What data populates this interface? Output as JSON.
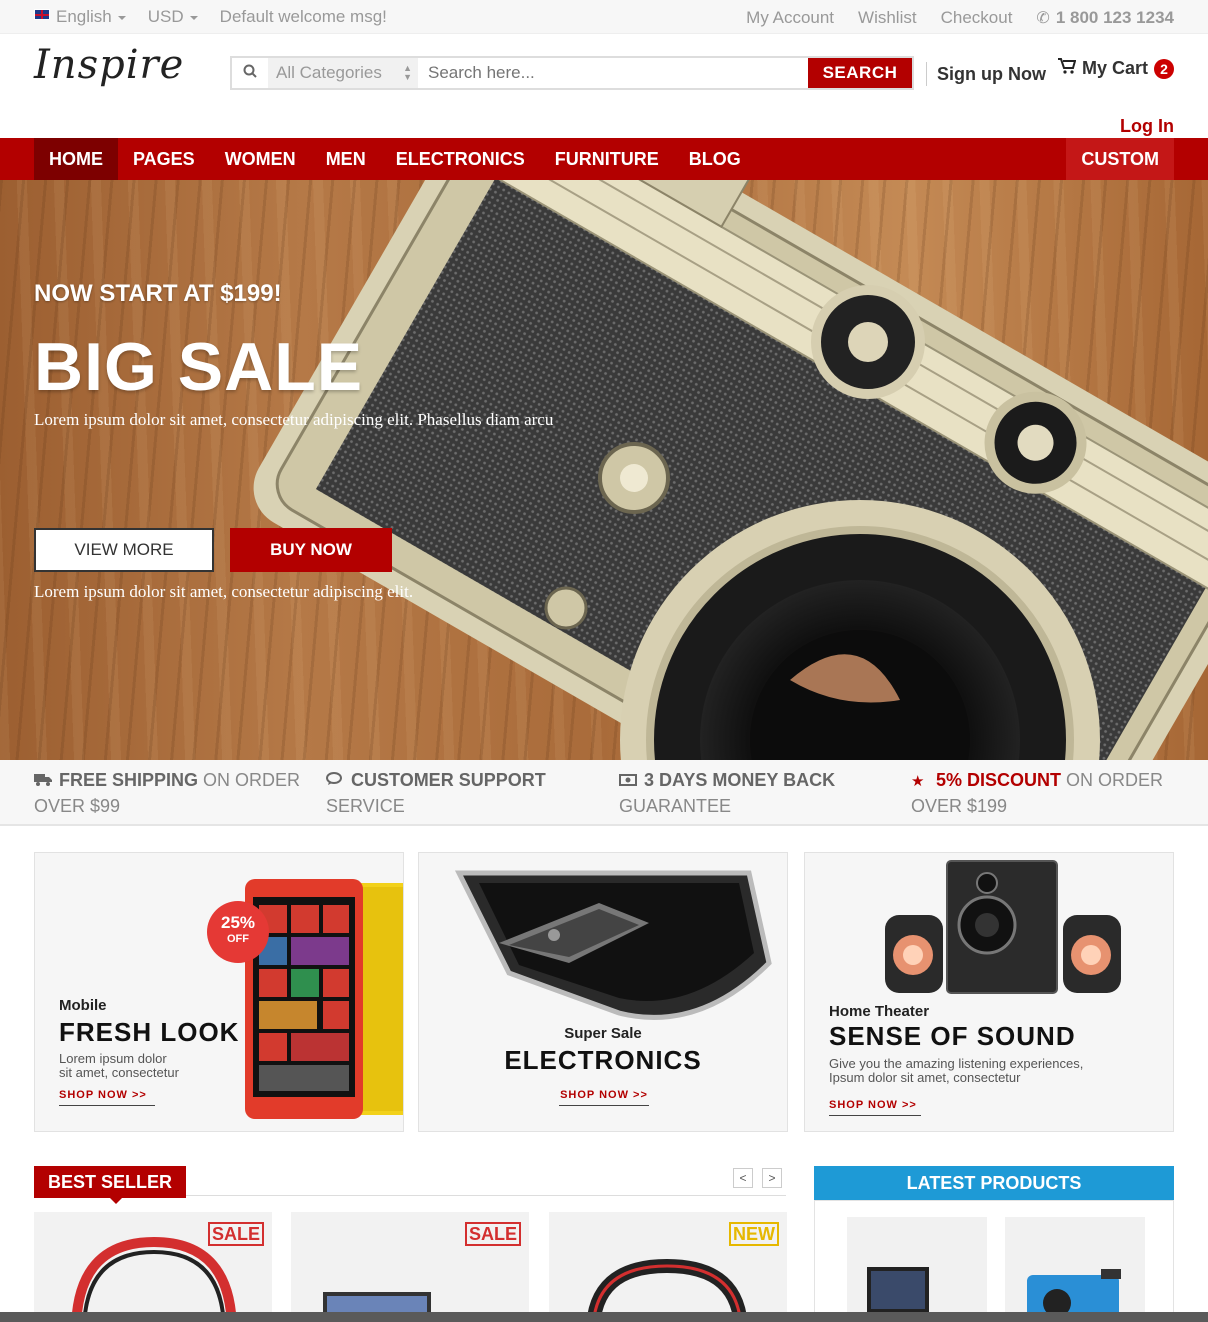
{
  "topbar": {
    "language": "English",
    "currency": "USD",
    "welcome": "Default welcome msg!",
    "links": [
      "My Account",
      "Wishlist",
      "Checkout"
    ],
    "phone": "1 800 123 1234"
  },
  "header": {
    "logo": "Inspire",
    "search": {
      "category": "All Categories",
      "placeholder": "Search here...",
      "button": "SEARCH"
    },
    "signup": "Sign up Now",
    "cart_label": "My Cart",
    "cart_count": "2",
    "login": "Log In"
  },
  "nav": {
    "items": [
      "HOME",
      "PAGES",
      "WOMEN",
      "MEN",
      "ELECTRONICS",
      "FURNITURE",
      "BLOG"
    ],
    "active": "HOME",
    "custom": "CUSTOM"
  },
  "hero": {
    "kicker": "NOW START AT $199!",
    "title": "BIG SALE",
    "desc1": "Lorem ipsum dolor sit amet, consectetur adipiscing elit. Phasellus diam arcu",
    "view_more": "VIEW MORE",
    "buy_now": "BUY NOW",
    "desc2": "Lorem ipsum dolor sit amet, consectetur adipiscing elit."
  },
  "features": [
    {
      "icon": "truck-icon",
      "strong": "FREE SHIPPING",
      "rest": " ON ORDER",
      "line2": "OVER $99"
    },
    {
      "icon": "chat-icon",
      "strong": "CUSTOMER SUPPORT",
      "rest": "",
      "line2": "SERVICE"
    },
    {
      "icon": "money-icon",
      "strong": "3 DAYS MONEY BACK",
      "rest": "",
      "line2": "GUARANTEE"
    },
    {
      "icon": "star-icon",
      "strong": "5% DISCOUNT",
      "rest": " ON ORDER",
      "line2": "OVER $199"
    }
  ],
  "promos": [
    {
      "sub": "Mobile",
      "title": "FRESH LOOK",
      "text1": "Lorem ipsum dolor",
      "text2": "sit amet, consectetur",
      "shop": "SHOP NOW >>",
      "badge_pct": "25%",
      "badge_off": "OFF"
    },
    {
      "sub": "Super Sale",
      "title": "ELECTRONICS",
      "shop": "SHOP NOW >>"
    },
    {
      "sub": "Home Theater",
      "title": "SENSE OF SOUND",
      "text1": "Give you the amazing listening experiences,",
      "text2": "Ipsum dolor sit amet, consectetur",
      "shop": "SHOP NOW >>"
    }
  ],
  "best_seller": {
    "title": "BEST SELLER",
    "prev": "<",
    "next": ">",
    "tags": [
      "SALE",
      "SALE",
      "NEW"
    ]
  },
  "latest_products": {
    "title": "LATEST PRODUCTS"
  },
  "colors": {
    "brand_red": "#b30000",
    "accent_blue": "#1e9ad6",
    "new_yellow": "#e6b800"
  }
}
